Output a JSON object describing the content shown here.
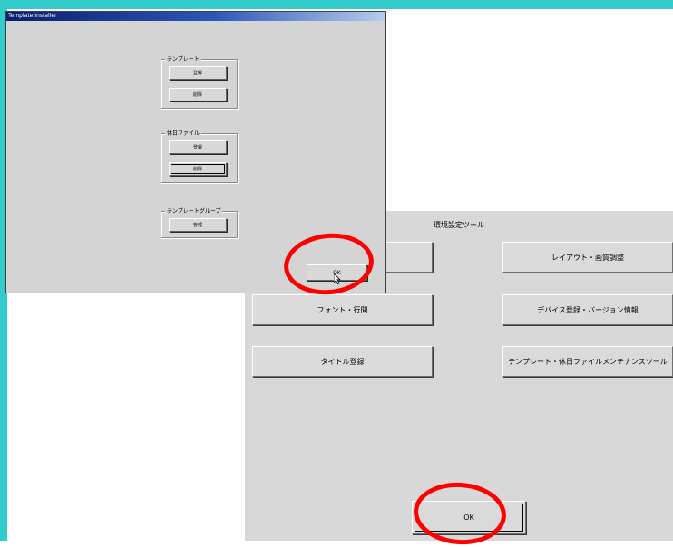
{
  "env_window": {
    "title": "環境設定ツール",
    "buttons": {
      "layout": "レイアウト・画質調整",
      "font": "フォント・行間",
      "device": "デバイス登録・バージョン情報",
      "title_reg": "タイトル登録",
      "template_tool": "テンプレート・休日ファイルメンテナンスツール"
    },
    "ok_label": "OK"
  },
  "template_installer": {
    "title": "Template Installer",
    "groups": {
      "template": {
        "label": "テンプレート",
        "register": "登録",
        "delete": "削除"
      },
      "holiday": {
        "label": "休日ファイル",
        "register": "登録",
        "delete": "削除"
      },
      "template_group": {
        "label": "テンプレートグループ",
        "manage": "管理"
      }
    },
    "ok_label": "OK"
  },
  "colors": {
    "accent_border": "#33cccc",
    "highlight_ring": "#ff0000",
    "titlebar_start": "#0a1e6e",
    "titlebar_end": "#b8cdee"
  }
}
